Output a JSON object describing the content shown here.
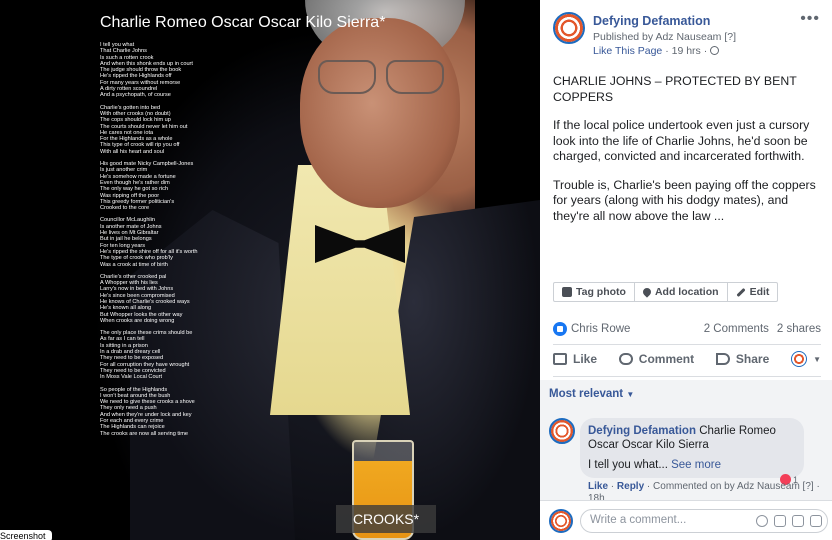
{
  "image": {
    "title": "Charlie Romeo Oscar Oscar Kilo Sierra*",
    "poem_stanzas": [
      [
        "I tell you what",
        "That Charlie Johns",
        "Is such a rotten crook",
        "And when this shonk ends up in court",
        "The judge should throw the book",
        "He's ripped the Highlands off",
        "For many years without remorse",
        "A dirty rotten scoundrel",
        "And a psychopath, of course"
      ],
      [
        "Charlie's gotten into bed",
        "With other crooks (no doubt)",
        "The cops should lock him up",
        "The courts should never let him out",
        "He cares not one iota",
        "For the Highlands as a whole",
        "This type of crook will rip you off",
        "With all his heart and soul"
      ],
      [
        "His good mate Nicky Campbell-Jones",
        "Is just another crim",
        "He's somehow made a fortune",
        "Even though he's rather dim",
        "The only way he got so rich",
        "Was ripping off the poor",
        "This greedy former politician's",
        "Crooked to the core"
      ],
      [
        "Councillor McLaughlin",
        "Is another mate of Johns",
        "He lives on Mt Gibraltar",
        "But in jail he belongs",
        "For ten long years",
        "He's ripped the shire off for all it's worth",
        "The type of crook who prob'ly",
        "Was a crook at time of birth"
      ],
      [
        "Charlie's other crooked pal",
        "A Whopper with his lies",
        "Larry's now in bed with Johns",
        "He's since been compromised",
        "He knows of Charlie's crooked ways",
        "He's known all along",
        "But Whopper looks the other way",
        "When crooks are doing wrong"
      ],
      [
        "The only place these crims should be",
        "As far as I can tell",
        "Is sitting in a prison",
        "In a drab and dreary cell",
        "They need to be exposed",
        "For all corruption they have wrought",
        "They need to be convicted",
        "In Moss Vale Local Court"
      ],
      [
        "So people of the Highlands",
        "I won't beat around the bush",
        "We need to give these crooks a shove",
        "They only need a push",
        "And when they're under lock and key",
        "For each and every crime",
        "The Highlands can rejoice",
        "The crooks are now all serving time"
      ]
    ],
    "caption": "CROOKS*",
    "corner_label": "Screenshot"
  },
  "post": {
    "page_name": "Defying Defamation",
    "published_by": "Published by Adz Nauseam [?]",
    "like_page": "Like This Page",
    "time": "· 19 hrs ·",
    "more": "•••",
    "paragraphs": [
      "CHARLIE JOHNS – PROTECTED BY BENT COPPERS",
      "If the local police undertook even just a cursory look into the life of Charlie Johns, he'd soon be charged, convicted and incarcerated forthwith.",
      "Trouble is, Charlie's been paying off the coppers for years (along with his dodgy mates), and they're all now above the law ..."
    ],
    "tag_photo": "Tag photo",
    "add_location": "Add location",
    "edit": "Edit",
    "reactor": "Chris Rowe",
    "comments_count": "2 Comments",
    "shares_count": "2 shares",
    "like": "Like",
    "comment": "Comment",
    "share": "Share"
  },
  "comments": {
    "sort": "Most relevant",
    "items": [
      {
        "author": "Defying Defamation",
        "title": "Charlie Romeo Oscar Oscar Kilo Sierra",
        "text": "I tell you what...",
        "see_more": "See more",
        "like": "Like",
        "reply": "Reply",
        "meta": "· Commented on by Adz Nauseam [?] ·",
        "time": "18h",
        "reactions": "1"
      }
    ],
    "write_placeholder": "Write a comment..."
  },
  "colors": {
    "link": "#385898",
    "like_blue": "#1877f2",
    "logo_orange": "#e3572b"
  }
}
